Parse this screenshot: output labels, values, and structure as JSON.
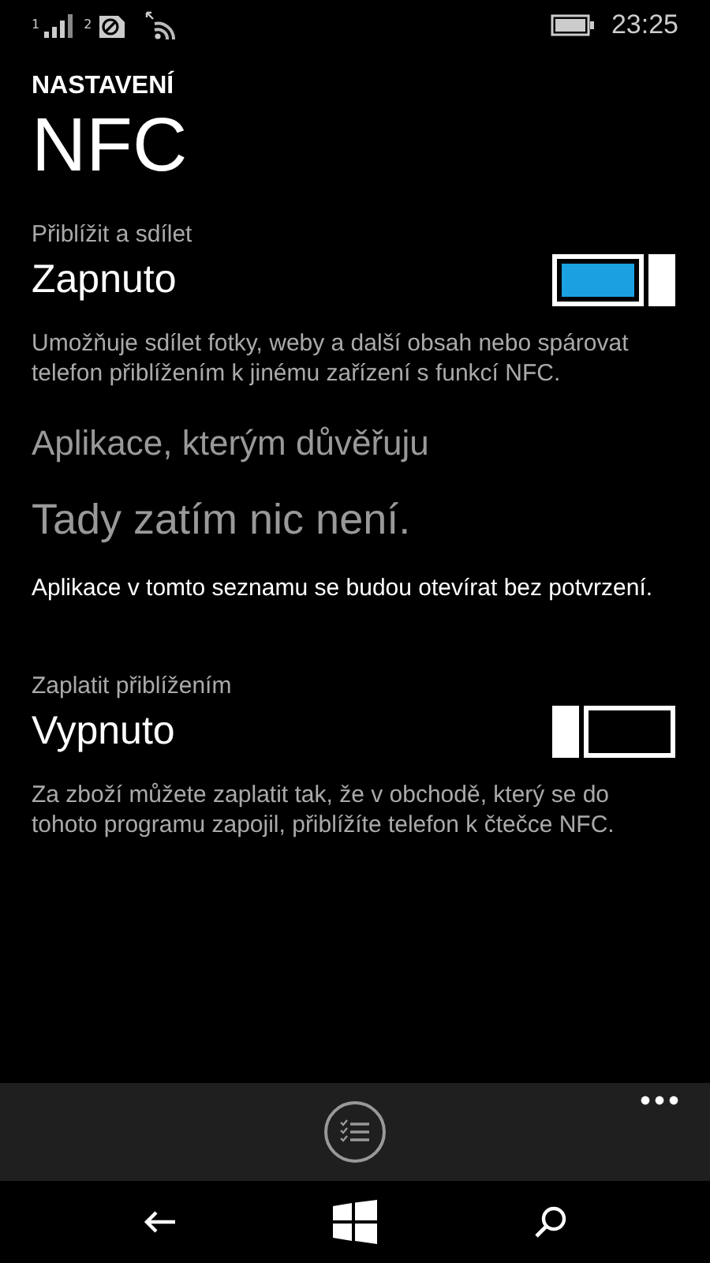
{
  "status_bar": {
    "sim_1": "1",
    "sim_2": "2",
    "time": "23:25"
  },
  "header": {
    "overline": "NASTAVENÍ",
    "title": "NFC"
  },
  "sections": [
    {
      "kind": "toggle",
      "label": "Přiblížit a sdílet",
      "state_text": "Zapnuto",
      "on": true,
      "description": "Umožňuje sdílet fotky, weby a další obsah nebo spárovat telefon přiblížením k jinému zařízení s funkcí NFC."
    },
    {
      "kind": "list",
      "heading": "Aplikace, kterým důvěřuju",
      "empty_text": "Tady zatím nic není.",
      "note": "Aplikace v tomto seznamu se budou otevírat bez potvrzení."
    },
    {
      "kind": "toggle",
      "label": "Zaplatit přiblížením",
      "state_text": "Vypnuto",
      "on": false,
      "description": "Za zboží můžete zaplatit tak, že v obchodě, který se do tohoto programu zapojil, přiblížíte telefon k čtečce NFC."
    }
  ]
}
